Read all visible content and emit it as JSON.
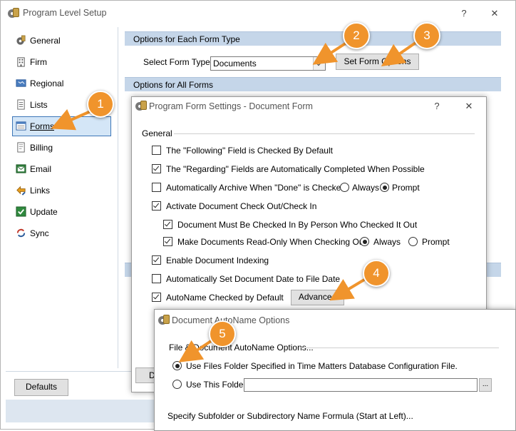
{
  "main_window": {
    "title": "Program Level Setup",
    "help_label": "?",
    "close_label": "✕"
  },
  "sidebar": {
    "items": [
      {
        "label": "General",
        "icon": "gear-icon"
      },
      {
        "label": "Firm",
        "icon": "building-icon"
      },
      {
        "label": "Regional",
        "icon": "map-icon"
      },
      {
        "label": "Lists",
        "icon": "list-icon"
      },
      {
        "label": "Forms",
        "icon": "form-icon",
        "selected": true
      },
      {
        "label": "Billing",
        "icon": "billing-icon"
      },
      {
        "label": "Email",
        "icon": "email-icon"
      },
      {
        "label": "Links",
        "icon": "link-icon"
      },
      {
        "label": "Update",
        "icon": "update-icon"
      },
      {
        "label": "Sync",
        "icon": "sync-icon"
      }
    ]
  },
  "main": {
    "section_each": "Options for Each Form Type",
    "select_form_type_label": "Select Form Type",
    "form_type_value": "Documents",
    "set_form_options_label": "Set Form Options",
    "section_all": "Options for All Forms"
  },
  "defaults_label": "Defaults",
  "form_dialog": {
    "title": "Program Form Settings - Document Form",
    "help_label": "?",
    "close_label": "✕",
    "group_title": "General",
    "options": [
      {
        "label": "The \"Following\" Field is Checked By Default",
        "checked": false
      },
      {
        "label": "The \"Regarding\" Fields are Automatically Completed When Possible",
        "checked": true
      },
      {
        "label": "Automatically Archive When \"Done\" is Checked",
        "checked": false
      },
      {
        "label": "Activate Document Check Out/Check In",
        "checked": true
      },
      {
        "label": "Document Must Be Checked In By Person Who Checked It Out",
        "checked": true
      },
      {
        "label": "Make Documents Read-Only When Checking Out",
        "checked": true
      },
      {
        "label": "Enable Document Indexing",
        "checked": true
      },
      {
        "label": "Automatically Set Document Date to File Date",
        "checked": false
      },
      {
        "label": "AutoName Checked by Default",
        "checked": true
      }
    ],
    "archive_radio": {
      "always": "Always",
      "prompt": "Prompt",
      "selected": "Prompt"
    },
    "readonly_radio": {
      "always": "Always",
      "prompt": "Prompt",
      "selected": "Always"
    },
    "advanced_label": "Advanced",
    "partial_button_label": "D"
  },
  "autoname_dialog": {
    "title": "Document AutoName Options",
    "group_title": "File & Document AutoName Options...",
    "option_files_folder": "Use Files Folder Specified in Time Matters Database Configuration File.",
    "option_this_folder": "Use This Folder",
    "folder_value": "",
    "browse_label": "...",
    "subfolder_text": "Specify Subfolder or Subdirectory Name Formula (Start at Left)...",
    "selected": "files_folder"
  },
  "callouts": [
    "1",
    "2",
    "3",
    "4",
    "5"
  ],
  "colors": {
    "accent_orange": "#f0942c",
    "section_header": "#c5d6e9",
    "selection": "#d4e6f7"
  }
}
